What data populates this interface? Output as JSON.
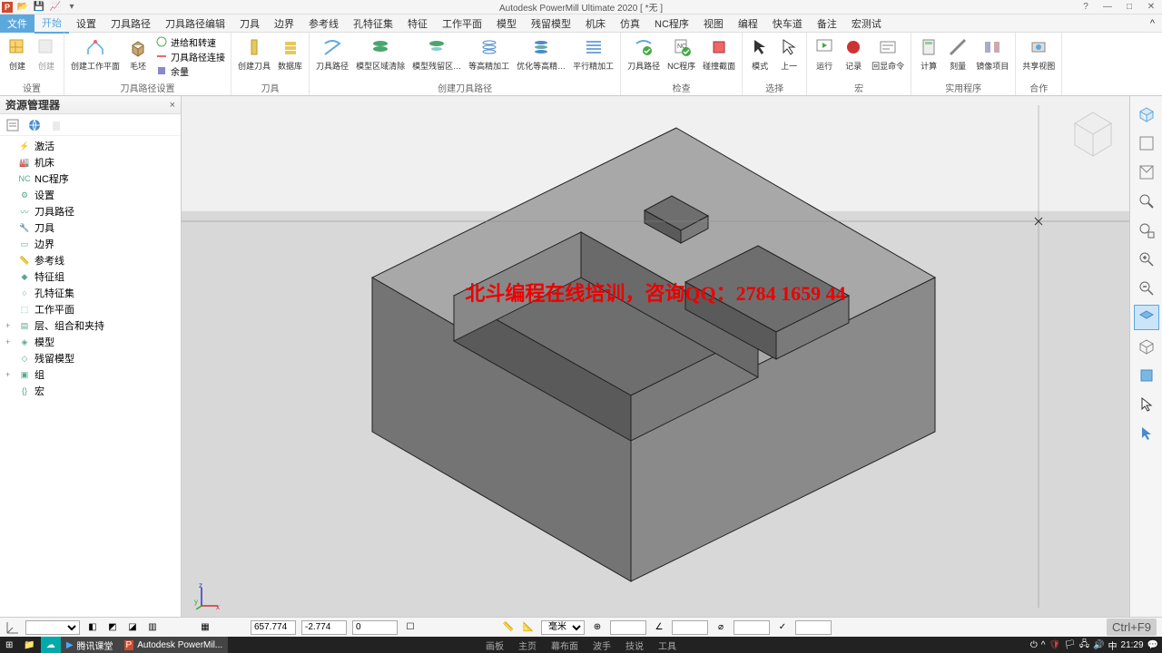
{
  "title": "Autodesk PowerMill Ultimate 2020    [ *无 ]",
  "menu_tabs": [
    "文件",
    "开始",
    "设置",
    "刀具路径",
    "刀具路径编辑",
    "刀具",
    "边界",
    "参考线",
    "孔特征集",
    "特征",
    "工作平面",
    "模型",
    "残留模型",
    "机床",
    "仿真",
    "NC程序",
    "视图",
    "编程",
    "快车道",
    "备注",
    "宏测试"
  ],
  "ribbon_groups": {
    "g0": {
      "label": "设置",
      "btns": [
        "创建",
        "创建"
      ]
    },
    "g1": {
      "label": "刀具路径设置",
      "btns": {
        "big": [
          "创建工作平面",
          "毛坯"
        ],
        "small": [
          "进给和转速",
          "刀具路径连接",
          "余量"
        ]
      }
    },
    "g2": {
      "label": "刀具",
      "btns": [
        "创建刀具",
        "数据库"
      ]
    },
    "g3": {
      "label": "创建刀具路径",
      "btns": [
        "刀具路径",
        "模型区域清除",
        "模型残留区…",
        "等高精加工",
        "优化等高精…",
        "平行精加工"
      ]
    },
    "g4": {
      "label": "检查",
      "btns": [
        "刀具路径",
        "NC程序",
        "碰撞截面"
      ]
    },
    "g5": {
      "label": "选择",
      "btns": [
        "模式",
        "上一"
      ]
    },
    "g6": {
      "label": "宏",
      "btns": [
        "运行",
        "记录",
        "回显命令"
      ]
    },
    "g7": {
      "label": "实用程序",
      "btns": [
        "计算",
        "刻量",
        "镜像项目"
      ]
    },
    "g8": {
      "label": "合作",
      "btns": [
        "共享视图"
      ]
    }
  },
  "explorer": {
    "title": "资源管理器",
    "items": [
      "激活",
      "机床",
      "NC程序",
      "设置",
      "刀具路径",
      "刀具",
      "边界",
      "参考线",
      "特征组",
      "孔特征集",
      "工作平面",
      "层、组合和夹持",
      "模型",
      "残留模型",
      "组",
      "宏"
    ]
  },
  "overlay": "北斗编程在线培训，咨询QQ：2784 1659 44",
  "status": {
    "coord_x": "657.774",
    "coord_y": "-2.774",
    "coord_z": "0",
    "unit": "毫米",
    "kbd_hint": "Ctrl+F9"
  },
  "taskbar": {
    "items": [
      "腾讯课堂",
      "Autodesk PowerMil..."
    ],
    "menus": [
      "画板",
      "主页",
      "幕布面",
      "波手",
      "技说",
      "工具"
    ],
    "time": "21:29"
  },
  "right_tools": [
    "iso",
    "top",
    "front",
    "zoom-fit",
    "zoom-sel",
    "zoom-in",
    "zoom-out",
    "shade",
    "wire",
    "block",
    "pick",
    "arrow"
  ]
}
